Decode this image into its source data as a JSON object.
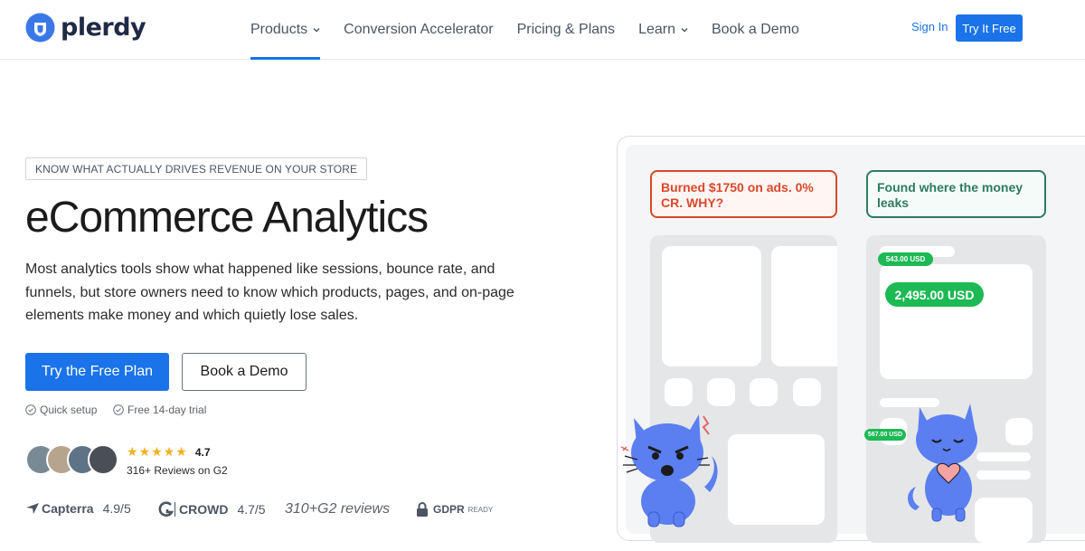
{
  "header": {
    "logo_text": "plerdy",
    "nav": [
      {
        "label": "Products",
        "has_dropdown": true,
        "active": true
      },
      {
        "label": "Conversion Accelerator",
        "has_dropdown": false
      },
      {
        "label": "Pricing & Plans",
        "has_dropdown": false
      },
      {
        "label": "Learn",
        "has_dropdown": true
      },
      {
        "label": "Book a Demo",
        "has_dropdown": false
      }
    ],
    "sign_in": "Sign In",
    "try_free": "Try It Free"
  },
  "hero": {
    "kicker": "KNOW WHAT ACTUALLY DRIVES REVENUE ON YOUR STORE",
    "title": "eCommerce Analytics",
    "description": "Most analytics tools show what happened like sessions, bounce rate, and funnels, but store owners need to know which products, pages, and on-page elements make money and which quietly lose sales.",
    "primary_cta": "Try the Free Plan",
    "secondary_cta": "Book a Demo",
    "features": [
      "Quick setup",
      "Free 14-day trial"
    ],
    "rating": {
      "stars": 4.7,
      "score": "4.7",
      "reviews": "316+ Reviews on G2"
    },
    "badges": {
      "capterra_label": "Capterra",
      "capterra_score": "4.9/5",
      "crowd_label": "CROWD",
      "crowd_score": "4.7/5",
      "g2_reviews": "310+G2 reviews",
      "gdpr_label": "GDPR",
      "gdpr_suffix": "READY"
    }
  },
  "illustration": {
    "bubble_left": "Burned $1750 on ads. 0% CR. WHY?",
    "bubble_right": "Found where the money leaks",
    "price_small_top": "543.00 USD",
    "price_large": "2,495.00 USD",
    "price_small_side": "567.00 USD"
  },
  "colors": {
    "accent": "#1a73e8",
    "alert_red": "#d9482b",
    "success_green": "#2f7a63",
    "price_green": "#1db954",
    "star": "#f2b01e",
    "cat_blue": "#5b7ff0"
  }
}
